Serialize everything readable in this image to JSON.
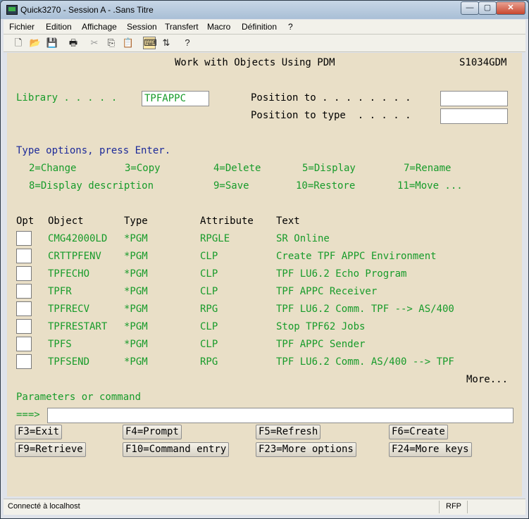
{
  "window": {
    "title": "Quick3270 - Session A - .Sans Titre",
    "minimize_glyph": "—",
    "maximize_glyph": "▢",
    "close_glyph": "✕"
  },
  "menubar": {
    "items": [
      "Fichier",
      "Edition",
      "Affichage",
      "Session",
      "Transfert",
      "Macro",
      "Définition",
      "?"
    ]
  },
  "toolbar": {
    "icons": [
      "new-file-icon",
      "open-folder-icon",
      "save-icon",
      "print-icon",
      "cut-icon",
      "copy-icon",
      "paste-icon",
      "keyboard-icon",
      "transfer-icon",
      "help-icon"
    ]
  },
  "screen": {
    "title": "Work with Objects Using PDM",
    "system": "S1034GDM",
    "library_label": "Library . . . . .",
    "library_value": "TPFAPPC",
    "position_to_label": "Position to . . . . . . . .",
    "position_to_type_label": "Position to type  . . . . .",
    "instruction": "Type options, press Enter.",
    "options_row1": [
      "2=Change",
      "3=Copy",
      "4=Delete",
      "5=Display",
      "7=Rename"
    ],
    "options_row2": [
      "8=Display description",
      "9=Save",
      "10=Restore",
      "11=Move ..."
    ],
    "columns": [
      "Opt",
      "Object",
      "Type",
      "Attribute",
      "Text"
    ],
    "rows": [
      {
        "object": "CMG42000LD",
        "type": "*PGM",
        "attribute": "RPGLE",
        "text": "SR Online"
      },
      {
        "object": "CRTTPFENV",
        "type": "*PGM",
        "attribute": "CLP",
        "text": "Create TPF APPC Environment"
      },
      {
        "object": "TPFECHO",
        "type": "*PGM",
        "attribute": "CLP",
        "text": "TPF LU6.2 Echo Program"
      },
      {
        "object": "TPFR",
        "type": "*PGM",
        "attribute": "CLP",
        "text": "TPF APPC Receiver"
      },
      {
        "object": "TPFRECV",
        "type": "*PGM",
        "attribute": "RPG",
        "text": "TPF LU6.2 Comm. TPF --> AS/400"
      },
      {
        "object": "TPFRESTART",
        "type": "*PGM",
        "attribute": "CLP",
        "text": "Stop TPF62 Jobs"
      },
      {
        "object": "TPFS",
        "type": "*PGM",
        "attribute": "CLP",
        "text": "TPF APPC Sender"
      },
      {
        "object": "TPFSEND",
        "type": "*PGM",
        "attribute": "RPG",
        "text": "TPF LU6.2 Comm. AS/400 --> TPF"
      }
    ],
    "more": "More...",
    "params_label": "Parameters or command",
    "prompt": "===>",
    "fkeys_row1": [
      "F3=Exit",
      "F4=Prompt",
      "F5=Refresh",
      "F6=Create"
    ],
    "fkeys_row2": [
      "F9=Retrieve",
      "F10=Command entry",
      "F23=More options",
      "F24=More keys"
    ]
  },
  "status": {
    "connection": "Connecté à localhost",
    "mode": "RFP"
  }
}
